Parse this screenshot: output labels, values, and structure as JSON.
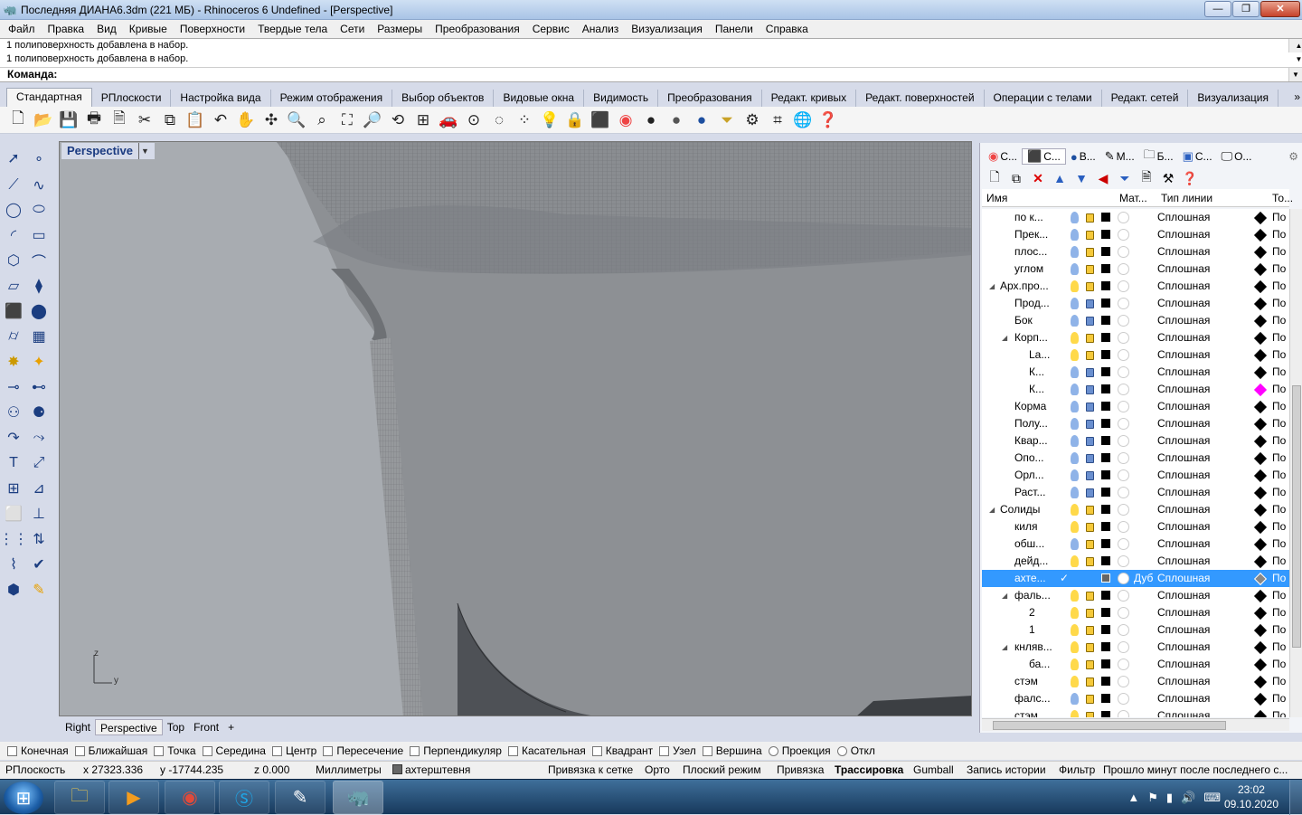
{
  "window": {
    "title": "Последняя ДИАНА6.3dm (221 МБ) - Rhinoceros 6 Undefined - [Perspective]",
    "min": "—",
    "max": "❐",
    "close": "✕"
  },
  "menu": [
    "Файл",
    "Правка",
    "Вид",
    "Кривые",
    "Поверхности",
    "Твердые тела",
    "Сети",
    "Размеры",
    "Преобразования",
    "Сервис",
    "Анализ",
    "Визуализация",
    "Панели",
    "Справка"
  ],
  "history": [
    "1 полиповерхность добавлена в набор.",
    "1 полиповерхность добавлена в набор."
  ],
  "command_label": "Команда:",
  "toolbar_tabs": [
    "Стандартная",
    "РПлоскости",
    "Настройка вида",
    "Режим отображения",
    "Выбор объектов",
    "Видовые окна",
    "Видимость",
    "Преобразования",
    "Редакт. кривых",
    "Редакт. поверхностей",
    "Операции с телами",
    "Редакт. сетей",
    "Визуализация"
  ],
  "toolbar_more": "»",
  "viewport": {
    "title": "Perspective",
    "axis_z": "z",
    "axis_y": "y",
    "tabs": [
      "Right",
      "Perspective",
      "Top",
      "Front"
    ],
    "add_tab": "+"
  },
  "panel": {
    "tabs": [
      "С...",
      "С...",
      "В...",
      "М...",
      "Б...",
      "С...",
      "О..."
    ],
    "headers": {
      "name": "Имя",
      "material": "Мат...",
      "linetype": "Тип линии",
      "print": "То..."
    },
    "layers": [
      {
        "indent": 2,
        "expand": "",
        "name": "по к...",
        "bulb": "blue",
        "lock": "open",
        "linetype": "Сплошная",
        "print": "По"
      },
      {
        "indent": 2,
        "expand": "",
        "name": "Прек...",
        "bulb": "blue",
        "lock": "open",
        "linetype": "Сплошная",
        "print": "По"
      },
      {
        "indent": 2,
        "expand": "",
        "name": "плос...",
        "bulb": "blue",
        "lock": "open",
        "linetype": "Сплошная",
        "print": "По"
      },
      {
        "indent": 2,
        "expand": "",
        "name": "углом",
        "bulb": "blue",
        "lock": "open",
        "linetype": "Сплошная",
        "print": "По"
      },
      {
        "indent": 1,
        "expand": "◢",
        "name": "Арх.про...",
        "bulb": "yellow",
        "lock": "open",
        "linetype": "Сплошная",
        "print": "По"
      },
      {
        "indent": 2,
        "expand": "",
        "name": "Прод...",
        "bulb": "blue",
        "lock": "closed",
        "linetype": "Сплошная",
        "print": "По"
      },
      {
        "indent": 2,
        "expand": "",
        "name": "Бок",
        "bulb": "blue",
        "lock": "closed",
        "linetype": "Сплошная",
        "print": "По"
      },
      {
        "indent": 2,
        "expand": "◢",
        "name": "Корп...",
        "bulb": "yellow",
        "lock": "open",
        "linetype": "Сплошная",
        "print": "По"
      },
      {
        "indent": 3,
        "expand": "",
        "name": "La...",
        "bulb": "yellow",
        "lock": "open",
        "linetype": "Сплошная",
        "print": "По"
      },
      {
        "indent": 3,
        "expand": "",
        "name": "К...",
        "bulb": "blue",
        "lock": "closed",
        "linetype": "Сплошная",
        "print": "По"
      },
      {
        "indent": 3,
        "expand": "",
        "name": "К...",
        "bulb": "blue",
        "lock": "closed",
        "linetype": "Сплошная",
        "print": "По",
        "print_color": "#ff00ff"
      },
      {
        "indent": 2,
        "expand": "",
        "name": "Корма",
        "bulb": "blue",
        "lock": "closed",
        "linetype": "Сплошная",
        "print": "По"
      },
      {
        "indent": 2,
        "expand": "",
        "name": "Полу...",
        "bulb": "blue",
        "lock": "closed",
        "linetype": "Сплошная",
        "print": "По"
      },
      {
        "indent": 2,
        "expand": "",
        "name": "Квар...",
        "bulb": "blue",
        "lock": "closed",
        "linetype": "Сплошная",
        "print": "По"
      },
      {
        "indent": 2,
        "expand": "",
        "name": "Опо...",
        "bulb": "blue",
        "lock": "closed",
        "linetype": "Сплошная",
        "print": "По"
      },
      {
        "indent": 2,
        "expand": "",
        "name": "Орл...",
        "bulb": "blue",
        "lock": "closed",
        "linetype": "Сплошная",
        "print": "По"
      },
      {
        "indent": 2,
        "expand": "",
        "name": "Раст...",
        "bulb": "blue",
        "lock": "closed",
        "linetype": "Сплошная",
        "print": "По"
      },
      {
        "indent": 1,
        "expand": "◢",
        "name": "Солиды",
        "bulb": "yellow",
        "lock": "open",
        "linetype": "Сплошная",
        "print": "По"
      },
      {
        "indent": 2,
        "expand": "",
        "name": "киля",
        "bulb": "yellow",
        "lock": "open",
        "linetype": "Сплошная",
        "print": "По"
      },
      {
        "indent": 2,
        "expand": "",
        "name": "обш...",
        "bulb": "blue",
        "lock": "open",
        "linetype": "Сплошная",
        "print": "По"
      },
      {
        "indent": 2,
        "expand": "",
        "name": "дейд...",
        "bulb": "yellow",
        "lock": "open",
        "linetype": "Сплошная",
        "print": "По"
      },
      {
        "indent": 2,
        "expand": "",
        "name": "ахте...",
        "current": "✓",
        "bulb": "",
        "lock": "",
        "material": "Дуб",
        "linetype": "Сплошная",
        "print": "По",
        "selected": true
      },
      {
        "indent": 2,
        "expand": "◢",
        "name": "фаль...",
        "bulb": "yellow",
        "lock": "open",
        "linetype": "Сплошная",
        "print": "По"
      },
      {
        "indent": 3,
        "expand": "",
        "name": "2",
        "bulb": "yellow",
        "lock": "open",
        "linetype": "Сплошная",
        "print": "По"
      },
      {
        "indent": 3,
        "expand": "",
        "name": "1",
        "bulb": "yellow",
        "lock": "open",
        "linetype": "Сплошная",
        "print": "По"
      },
      {
        "indent": 2,
        "expand": "◢",
        "name": "кнляв...",
        "bulb": "yellow",
        "lock": "open",
        "linetype": "Сплошная",
        "print": "По"
      },
      {
        "indent": 3,
        "expand": "",
        "name": "ба...",
        "bulb": "yellow",
        "lock": "open",
        "linetype": "Сплошная",
        "print": "По"
      },
      {
        "indent": 2,
        "expand": "",
        "name": "стэм",
        "bulb": "yellow",
        "lock": "open",
        "linetype": "Сплошная",
        "print": "По"
      },
      {
        "indent": 2,
        "expand": "",
        "name": "фалс...",
        "bulb": "blue",
        "lock": "open",
        "linetype": "Сплошная",
        "print": "По"
      },
      {
        "indent": 2,
        "expand": "",
        "name": "стэм",
        "bulb": "yellow",
        "lock": "open",
        "linetype": "Сплошная",
        "print": "По"
      }
    ]
  },
  "osnaps": [
    "Конечная",
    "Ближайшая",
    "Точка",
    "Середина",
    "Центр",
    "Пересечение",
    "Перпендикуляр",
    "Касательная",
    "Квадрант",
    "Узел",
    "Вершина",
    "Проекция",
    "Откл"
  ],
  "status": {
    "cplane": "РПлоскость",
    "x": "x 27323.336",
    "y": "y -17744.235",
    "z": "z 0.000",
    "units": "Миллиметры",
    "layer": "ахтерштевня",
    "grid_snap": "Привязка к сетке",
    "ortho": "Орто",
    "planar": "Плоский режим",
    "osnap": "Привязка",
    "smarttrack": "Трассировка",
    "gumball": "Gumball",
    "history": "Запись истории",
    "filter": "Фильтр",
    "message": "Прошло минут после последнего с..."
  },
  "taskbar": {
    "time": "23:02",
    "date": "09.10.2020"
  }
}
